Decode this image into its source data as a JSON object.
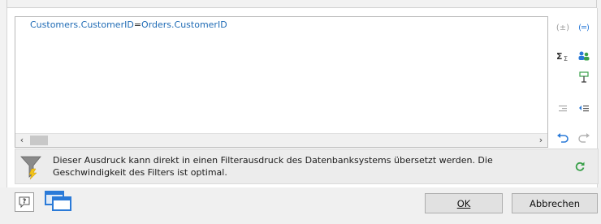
{
  "editor": {
    "expression_left": "Customers.CustomerID",
    "operator": "=",
    "expression_right": "Orders.CustomerID"
  },
  "side_icons": [
    {
      "name": "parentheses-icon"
    },
    {
      "name": "function-brackets-icon"
    },
    {
      "name": "sum-aggregate-icon"
    },
    {
      "name": "users-group-icon"
    },
    {
      "name": "insert-field-icon"
    },
    {
      "name": "indent-left-icon"
    },
    {
      "name": "indent-right-icon"
    },
    {
      "name": "undo-icon"
    },
    {
      "name": "redo-icon"
    }
  ],
  "info": {
    "message": "Dieser Ausdruck kann direkt in einen Filterausdruck des Datenbanksystems übersetzt werden. Die Geschwindigkeit des Filters ist optimal."
  },
  "buttons": {
    "ok_label": "OK",
    "cancel_label": "Abbrechen",
    "help_label": "?"
  },
  "colors": {
    "expression_blue": "#1f6bb5",
    "icon_blue": "#2a7ad8",
    "icon_green": "#3aa04a"
  }
}
